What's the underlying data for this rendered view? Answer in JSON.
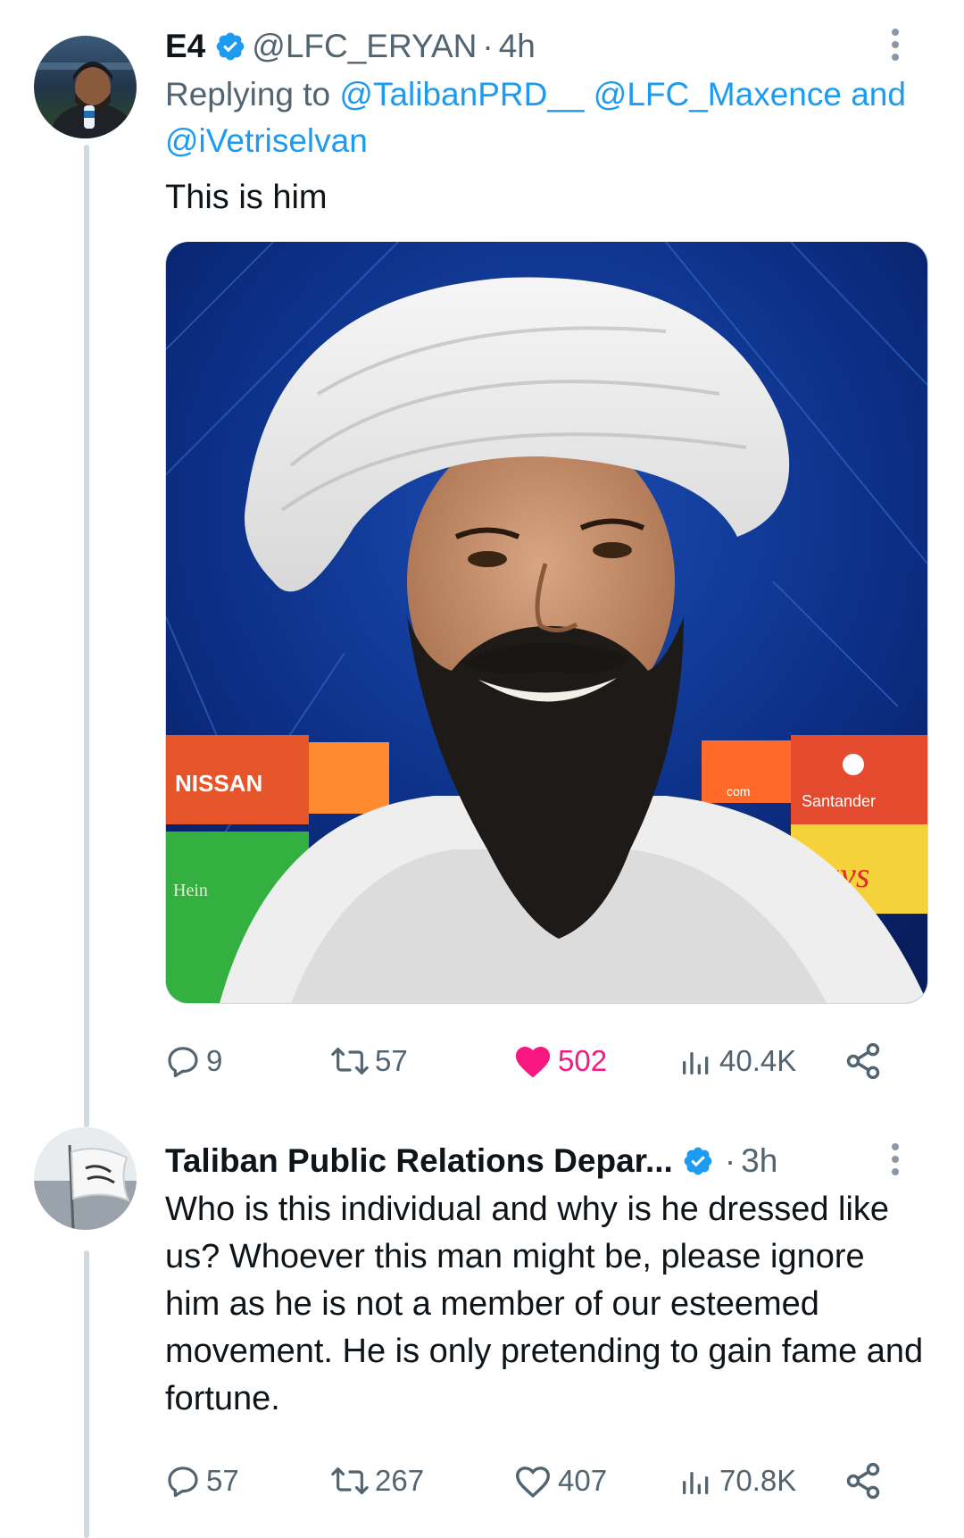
{
  "tweet1": {
    "display_name": "E4",
    "handle": "@LFC_ERYAN",
    "separator": "·",
    "time": "4h",
    "reply_prefix": "Replying to",
    "reply_mentions": [
      "@TalibanPRD__",
      "@LFC_Maxence"
    ],
    "reply_and": "and",
    "reply_last": "@iVetriselvan",
    "text": "This is him",
    "media_sponsor_left": "NISSAN",
    "media_sponsor_right": "Santander",
    "media_sponsor_lower_left": "Hein",
    "media_sponsor_lower_right": "lays",
    "media_sponsor_com": "com",
    "replies": "9",
    "retweets": "57",
    "likes": "502",
    "views": "40.4K",
    "liked": true
  },
  "tweet2": {
    "display_name": "Taliban Public Relations Depar...",
    "separator": "·",
    "time": "3h",
    "text": "Who is this individual and why is he dressed like us? Whoever this man might be, please ignore him as he is not a member of our esteemed movement. He is only pretending to gain fame and fortune.",
    "replies": "57",
    "retweets": "267",
    "likes": "407",
    "views": "70.8K",
    "liked": false
  },
  "icons": {
    "verified": "verified-badge-icon",
    "more": "more-options-icon",
    "reply": "reply-bubble-icon",
    "retweet": "retweet-icon",
    "like": "heart-icon",
    "views": "views-bar-chart-icon",
    "share": "share-icon"
  },
  "colors": {
    "link": "#1d9bf0",
    "muted": "#536471",
    "like_active": "#f91880",
    "verified": "#1d9bf0",
    "thread_line": "#cfd9de"
  }
}
